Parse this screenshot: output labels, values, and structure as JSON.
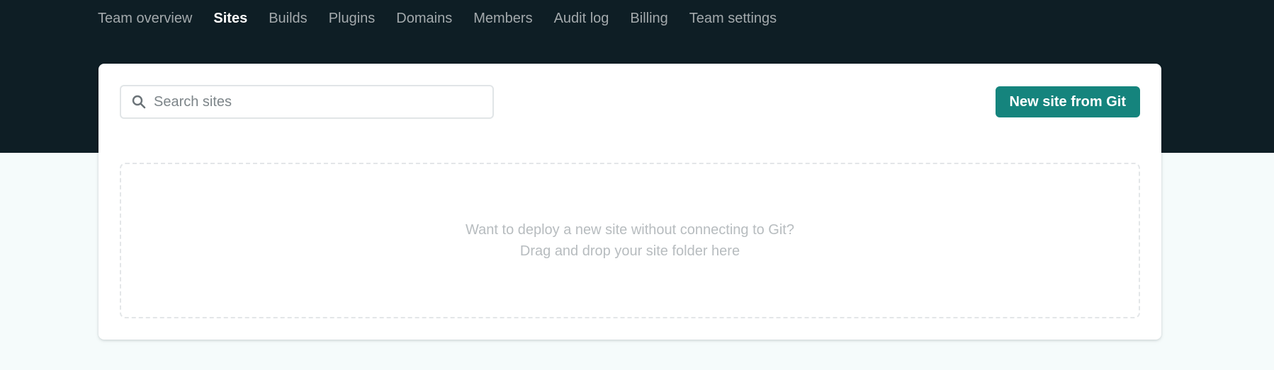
{
  "nav": {
    "items": [
      {
        "label": "Team overview"
      },
      {
        "label": "Sites"
      },
      {
        "label": "Builds"
      },
      {
        "label": "Plugins"
      },
      {
        "label": "Domains"
      },
      {
        "label": "Members"
      },
      {
        "label": "Audit log"
      },
      {
        "label": "Billing"
      },
      {
        "label": "Team settings"
      }
    ],
    "active": "Sites"
  },
  "search": {
    "placeholder": "Search sites",
    "value": "",
    "icon": "search-icon"
  },
  "actions": {
    "new_site_label": "New site from Git"
  },
  "dropzone": {
    "line1": "Want to deploy a new site without connecting to Git?",
    "line2": "Drag and drop your site folder here"
  },
  "colors": {
    "header_bg": "#0e1e25",
    "page_bg": "#f5fbfb",
    "accent": "#15847d",
    "nav_active": "#ffffff",
    "nav_inactive": "#a3a9ac"
  }
}
